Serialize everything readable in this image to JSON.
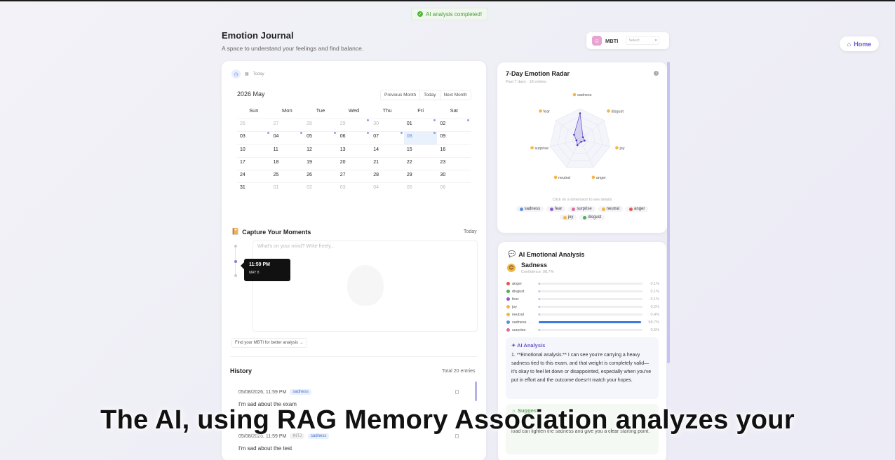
{
  "toast": {
    "text": "AI analysis completed!"
  },
  "header": {
    "title": "Emotion Journal",
    "subtitle": "A space to understand your feelings and find balance."
  },
  "mbti": {
    "label": "MBTI",
    "select_placeholder": "Select"
  },
  "home": {
    "label": "Home"
  },
  "calendar": {
    "today_label": "Today",
    "month_label": "2026 May",
    "nav": {
      "prev": "Previous Month",
      "today": "Today",
      "next": "Next Month"
    },
    "weekdays": [
      "Sun",
      "Mon",
      "Tue",
      "Wed",
      "Thu",
      "Fri",
      "Sat"
    ],
    "weeks": [
      [
        {
          "d": "26",
          "dim": true
        },
        {
          "d": "27",
          "dim": true
        },
        {
          "d": "28",
          "dim": true
        },
        {
          "d": "29",
          "dim": true,
          "mark": true
        },
        {
          "d": "30",
          "dim": true
        },
        {
          "d": "01",
          "mark": true
        },
        {
          "d": "02",
          "mark": true
        }
      ],
      [
        {
          "d": "03",
          "mark": true
        },
        {
          "d": "04",
          "mark": true
        },
        {
          "d": "05",
          "mark": true
        },
        {
          "d": "06",
          "mark": true
        },
        {
          "d": "07",
          "mark": true
        },
        {
          "d": "08",
          "sel": true,
          "mark": true
        },
        {
          "d": "09"
        }
      ],
      [
        {
          "d": "10"
        },
        {
          "d": "11"
        },
        {
          "d": "12"
        },
        {
          "d": "13"
        },
        {
          "d": "14"
        },
        {
          "d": "15"
        },
        {
          "d": "16"
        }
      ],
      [
        {
          "d": "17"
        },
        {
          "d": "18"
        },
        {
          "d": "19"
        },
        {
          "d": "20"
        },
        {
          "d": "21"
        },
        {
          "d": "22"
        },
        {
          "d": "23"
        }
      ],
      [
        {
          "d": "24"
        },
        {
          "d": "25"
        },
        {
          "d": "26"
        },
        {
          "d": "27"
        },
        {
          "d": "28"
        },
        {
          "d": "29"
        },
        {
          "d": "30"
        }
      ],
      [
        {
          "d": "31"
        },
        {
          "d": "01",
          "dim": true
        },
        {
          "d": "02",
          "dim": true
        },
        {
          "d": "03",
          "dim": true
        },
        {
          "d": "04",
          "dim": true
        },
        {
          "d": "05",
          "dim": true
        },
        {
          "d": "06",
          "dim": true
        }
      ]
    ]
  },
  "capture": {
    "title": "Capture Your Moments",
    "right_label": "Today",
    "placeholder": "What's on your mind? Write freely...",
    "tooltip_time": "11:59 PM",
    "tooltip_date": "MAY 8",
    "mbti_link": "Find your MBTI for better analysis →"
  },
  "history": {
    "title": "History",
    "total": "Total 20 entries",
    "items": [
      {
        "date": "05/08/2026, 11:59 PM",
        "tags": [
          {
            "label": "sadness",
            "type": "blue"
          }
        ],
        "text": "I'm sad about the exam"
      },
      {
        "date": "05/08/2026, 11:59 PM",
        "tags": [
          {
            "label": "INTJ",
            "type": "gray"
          },
          {
            "label": "sadness",
            "type": "blue"
          }
        ],
        "text": "I'm sad about the test"
      }
    ]
  },
  "radar": {
    "title": "7-Day Emotion Radar",
    "subtitle": "Past 7 days · 18 entries",
    "hint": "Click on a dimension to see details",
    "axes": [
      "sadness",
      "disgust",
      "joy",
      "anger",
      "neutral",
      "surprise",
      "fear"
    ],
    "values": [
      0.85,
      0.12,
      0.15,
      0.08,
      0.2,
      0.12,
      0.25
    ],
    "legend": [
      {
        "label": "sadness",
        "color": "#5b8fd9"
      },
      {
        "label": "fear",
        "color": "#8a5cc7"
      },
      {
        "label": "surprise",
        "color": "#e06a9c"
      },
      {
        "label": "neutral",
        "color": "#f0b840"
      },
      {
        "label": "anger",
        "color": "#e05a4a"
      },
      {
        "label": "joy",
        "color": "#f4b740"
      },
      {
        "label": "disgust",
        "color": "#4caf50"
      }
    ]
  },
  "analysis": {
    "title": "AI Emotional Analysis",
    "top_emotion": "Sadness",
    "confidence": "Confidence: 98.7%",
    "bars": [
      {
        "name": "anger",
        "pct": "0.1%",
        "value": 0.001,
        "color": "#e05a4a"
      },
      {
        "name": "disgust",
        "pct": "0.1%",
        "value": 0.001,
        "color": "#4caf50"
      },
      {
        "name": "fear",
        "pct": "0.1%",
        "value": 0.001,
        "color": "#8a5cc7"
      },
      {
        "name": "joy",
        "pct": "0.2%",
        "value": 0.002,
        "color": "#f4b740"
      },
      {
        "name": "neutral",
        "pct": "0.4%",
        "value": 0.004,
        "color": "#f0b840"
      },
      {
        "name": "sadness",
        "pct": "98.7%",
        "value": 0.987,
        "color": "#5b8fd9"
      },
      {
        "name": "surprise",
        "pct": "0.5%",
        "value": 0.005,
        "color": "#e06a9c"
      }
    ],
    "ai_title": "AI Analysis",
    "ai_text": "1. **Emotional analysis:** I can see you're carrying a heavy sadness tied to this exam, and that weight is completely valid—it's okay to feel let down or disappointed, especially when you've put in effort and the outcome doesn't match your hopes.",
    "suggest_title": "Suggest",
    "suggest_text": "load can lighten the sadness and give you a clear starting point."
  },
  "caption": {
    "text": "The AI, using RAG Memory Association analyzes your"
  }
}
